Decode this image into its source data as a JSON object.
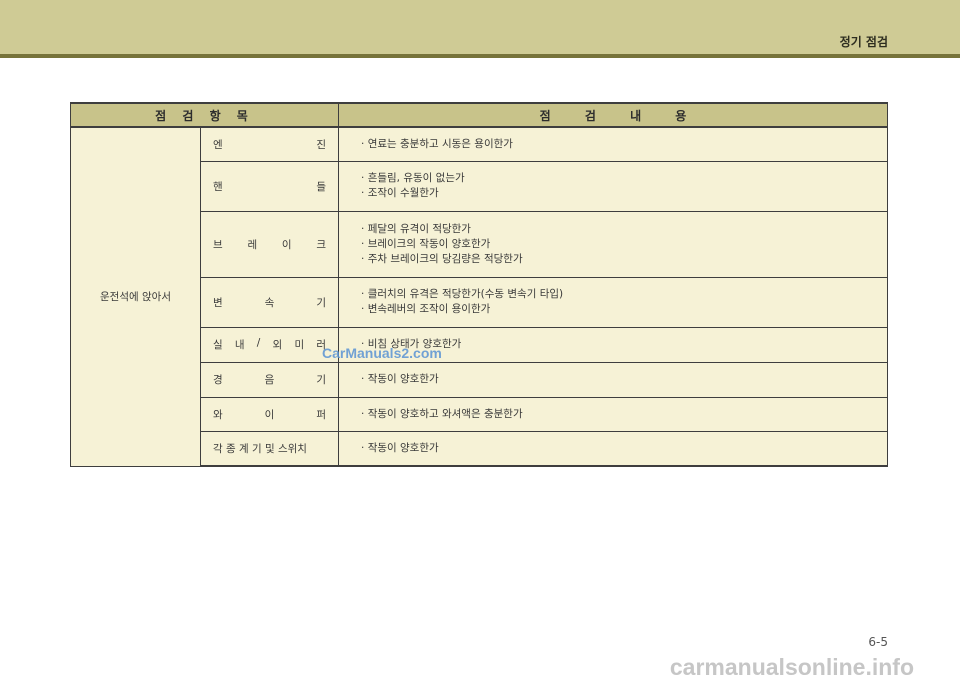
{
  "header": {
    "section_title": "정기 점검"
  },
  "table": {
    "headers": [
      "점 검 항 목",
      "점 검 내 용"
    ],
    "location": "운전석에 앉아서",
    "rows": [
      {
        "item": [
          "엔",
          "진"
        ],
        "content": [
          "· 연료는 충분하고 시동은 용이한가"
        ]
      },
      {
        "item": [
          "핸",
          "들"
        ],
        "content": [
          "· 흔들림, 유동이 없는가",
          "· 조작이 수월한가"
        ]
      },
      {
        "item": [
          "브",
          "레",
          "이",
          "크"
        ],
        "content": [
          "· 페달의 유격이 적당한가",
          "· 브레이크의 작동이 양호한가",
          "· 주차 브레이크의 당김량은 적당한가"
        ]
      },
      {
        "item": [
          "변",
          "속",
          "기"
        ],
        "content": [
          "· 클러치의 유격은 적당한가(수동 변속기 타입)",
          "· 변속레버의 조작이 용이한가"
        ]
      },
      {
        "item": [
          "실",
          "내",
          "/",
          "외",
          "미",
          "러"
        ],
        "content": [
          "· 비침 상태가 양호한가"
        ]
      },
      {
        "item": [
          "경",
          "음",
          "기"
        ],
        "content": [
          "· 작동이 양호한가"
        ]
      },
      {
        "item": [
          "와",
          "이",
          "퍼"
        ],
        "content": [
          "· 작동이 양호하고 와셔액은 충분한가"
        ]
      },
      {
        "item": [
          "각 종 계 기 및 스위치"
        ],
        "content": [
          "· 작동이 양호한가"
        ]
      }
    ]
  },
  "watermark": "CarManuals2.com",
  "page_number": "6-5",
  "footer_watermark": "carmanualsonline.info"
}
